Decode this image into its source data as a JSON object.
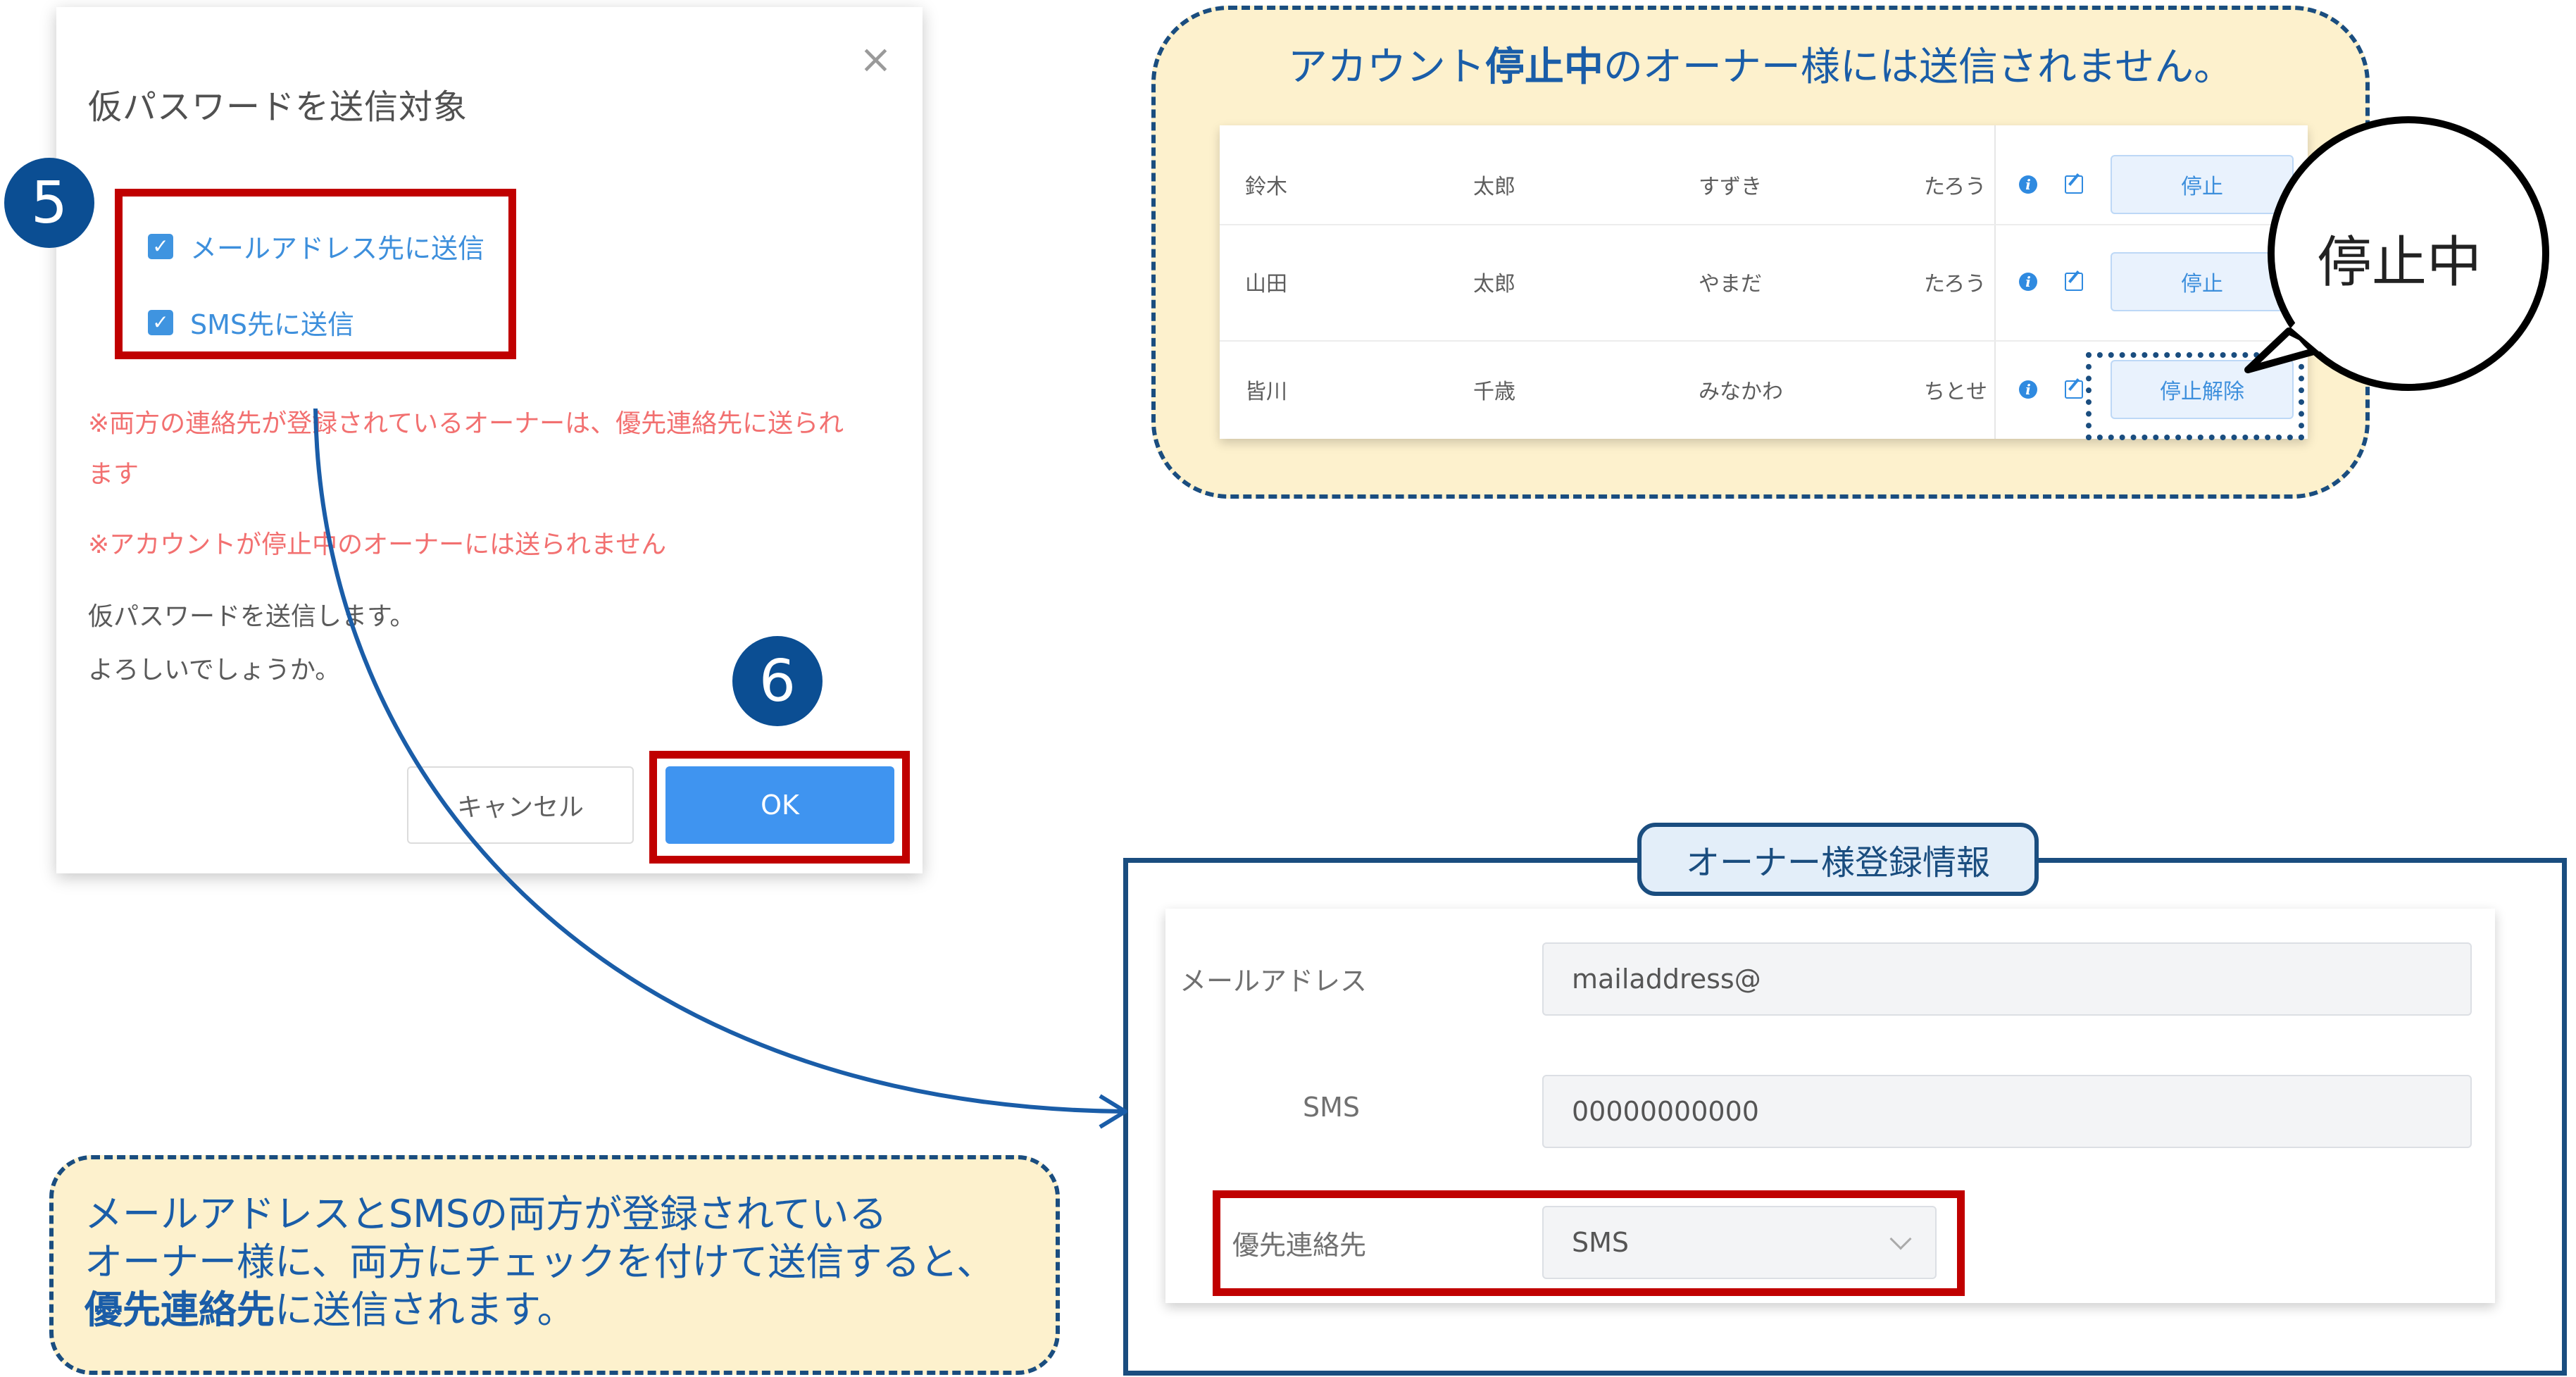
{
  "dialog": {
    "title": "仮パスワードを送信対象",
    "close_glyph": "×",
    "checkbox_email_label": "メールアドレス先に送信",
    "checkbox_sms_label": "SMS先に送信",
    "check_glyph": "✓",
    "note1_line1": "※両方の連絡先が登録されているオーナーは、優先連絡先に送られ",
    "note1_line2": "ます",
    "note2": "※アカウントが停止中のオーナーには送られません",
    "body_line1": "仮パスワードを送信します。",
    "body_line2": "よろしいでしょうか。",
    "cancel_label": "キャンセル",
    "ok_label": "OK"
  },
  "steps": {
    "five": "5",
    "six": "6"
  },
  "notice": {
    "title_pre": "アカウント",
    "title_bold": "停止中",
    "title_post": "のオーナー様には送信されません。",
    "rows": [
      {
        "last": "鈴木",
        "first": "太郎",
        "last_kana": "すずき",
        "first_kana": "たろう",
        "action": "停止"
      },
      {
        "last": "山田",
        "first": "太郎",
        "last_kana": "やまだ",
        "first_kana": "たろう",
        "action": "停止"
      },
      {
        "last": "皆川",
        "first": "千歳",
        "last_kana": "みなかわ",
        "first_kana": "ちとせ",
        "action": "停止解除"
      }
    ],
    "info_glyph": "i",
    "bubble": "停止中"
  },
  "owner_info": {
    "label": "オーナー様登録情報",
    "email_label": "メールアドレス",
    "email_value": "mailaddress@",
    "sms_label": "SMS",
    "sms_value": "00000000000",
    "priority_label": "優先連絡先",
    "priority_value": "SMS"
  },
  "bottom_note": {
    "line1": "メールアドレスとSMSの両方が登録されている",
    "line2": "オーナー様に、両方にチェックを付けて送信すると、",
    "line3_bold": "優先連絡先",
    "line3_rest": "に送信されます。"
  },
  "colors": {
    "accent_blue": "#1a4d7f",
    "highlight_red": "#c00000",
    "note_bg": "#fdf1cd",
    "ok_button": "#3f94f0"
  }
}
